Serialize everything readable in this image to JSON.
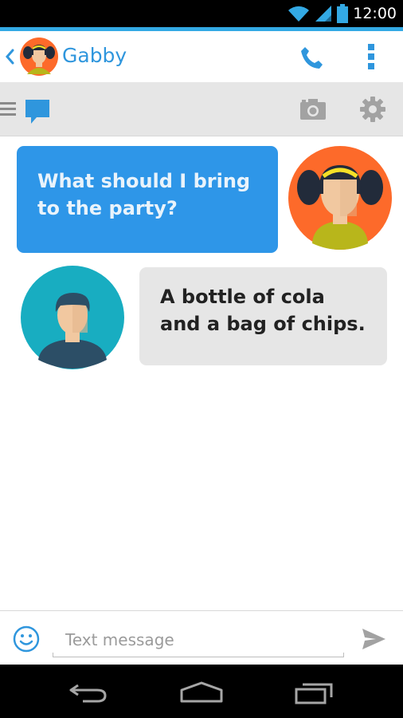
{
  "status_bar": {
    "time": "12:00"
  },
  "header": {
    "contact_name": "Gabby",
    "icons": {
      "back": "chevron-left-icon",
      "call": "phone-icon",
      "overflow": "more-vertical-icon"
    },
    "accent_color": "#2f96dd"
  },
  "toolbar": {
    "icons": {
      "menu": "menu-icon",
      "chat": "chat-icon",
      "camera": "camera-icon",
      "settings": "gear-icon"
    }
  },
  "conversation": {
    "messages": [
      {
        "sender": "Gabby",
        "direction": "sent",
        "lines": [
          "What should I bring",
          "to the party?"
        ],
        "color": "#2e96e8"
      },
      {
        "sender": "me",
        "direction": "received",
        "lines": [
          "A bottle of cola",
          "and a bag of chips."
        ],
        "color": "#e6e6e6"
      }
    ]
  },
  "composer": {
    "placeholder": "Text message",
    "value": "",
    "icons": {
      "emoji": "smiley-icon",
      "send": "send-icon"
    }
  },
  "nav_bar": {
    "icons": [
      "back-icon",
      "home-icon",
      "recents-icon"
    ]
  }
}
